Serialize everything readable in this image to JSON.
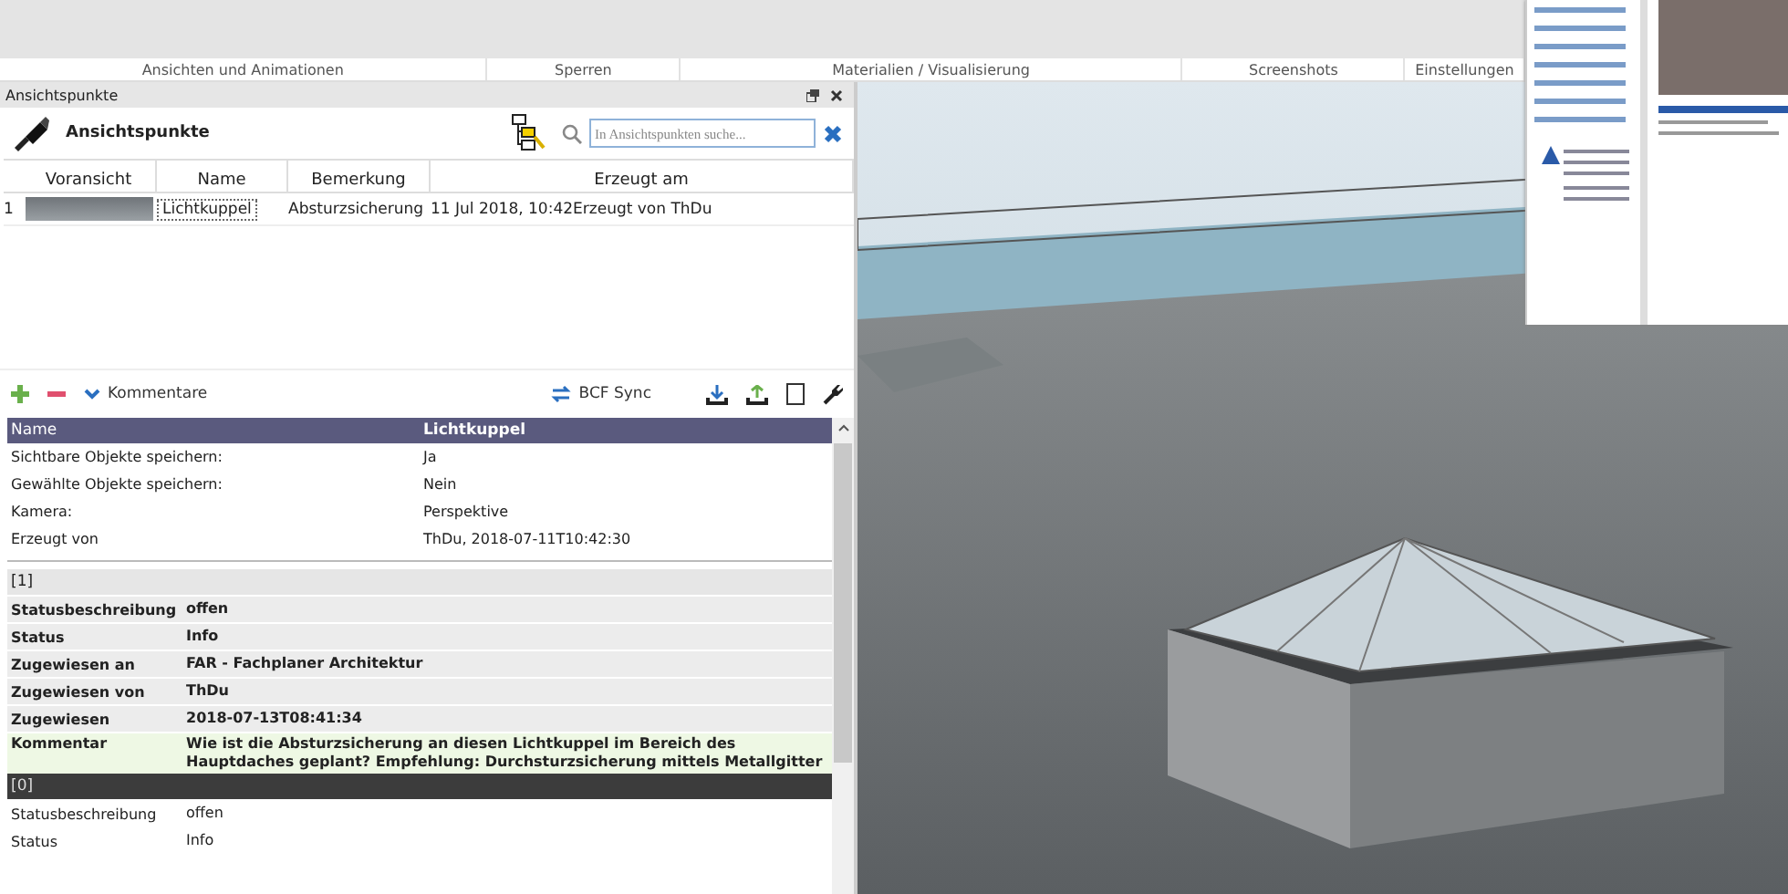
{
  "ribbon_groups": [
    "Ansichten und Animationen",
    "Sperren",
    "Materialien / Visualisierung",
    "Screenshots",
    "Einstellungen"
  ],
  "panel": {
    "title": "Ansichtspunkte",
    "heading": "Ansichtspunkte",
    "search": {
      "placeholder": "In Ansichtspunkten suche..."
    },
    "table": {
      "columns": [
        "Voransicht",
        "Name",
        "Bemerkung",
        "Erzeugt am"
      ],
      "rows": [
        {
          "index": "1",
          "name": "Lichtkuppel",
          "remark": "Absturzsicherung",
          "created": "11 Jul 2018, 10:42Erzeugt von ThDu",
          "selected": true
        }
      ]
    },
    "toolbar": {
      "comments": "Kommentare",
      "sync": "BCF Sync"
    },
    "properties": {
      "header": {
        "label": "Name",
        "value": "Lichtkuppel"
      },
      "rows": [
        {
          "label": "Sichtbare Objekte speichern:",
          "value": "Ja"
        },
        {
          "label": "Gewählte Objekte speichern:",
          "value": "Nein"
        },
        {
          "label": "Kamera:",
          "value": "Perspektive"
        },
        {
          "label": "Erzeugt von",
          "value": "ThDu, 2018-07-11T10:42:30"
        }
      ]
    },
    "comments": [
      {
        "index": "[1]",
        "selected": true,
        "fields": [
          {
            "kind": "text",
            "label": "Statusbeschreibung",
            "value": "offen"
          },
          {
            "kind": "text",
            "label": "Status",
            "value": "Info"
          },
          {
            "kind": "text",
            "label": "Zugewiesen an",
            "value": "FAR - Fachplaner Architektur"
          },
          {
            "kind": "text",
            "label": "Zugewiesen von",
            "value": "ThDu"
          },
          {
            "kind": "text",
            "label": "Zugewiesen",
            "value": "2018-07-13T08:41:34"
          },
          {
            "kind": "comment",
            "label": "Kommentar",
            "value": "Wie ist die Absturzsicherung an diesen Lichtkuppel im Bereich des Hauptdaches geplant? Empfehlung: Durchsturzsicherung mittels Metallgitter"
          }
        ]
      },
      {
        "index": "[0]",
        "selected": false,
        "fields": [
          {
            "kind": "text",
            "label": "Statusbeschreibung",
            "value": "offen"
          },
          {
            "kind": "text",
            "label": "Status",
            "value": "Info"
          }
        ]
      }
    ]
  }
}
